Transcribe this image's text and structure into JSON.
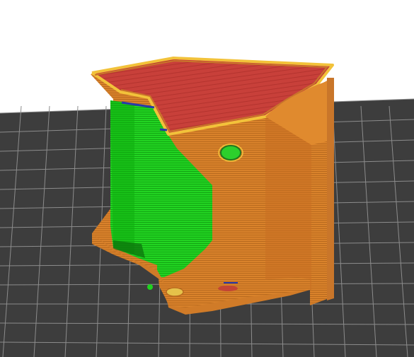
{
  "viewport": {
    "background_color": "#ffffff",
    "bed_color": "#3d3d3d",
    "bed_grid_color": "#8c8c8c"
  },
  "model": {
    "top_surface_color": "#c03838",
    "perimeter_color": "#d9822b",
    "perimeter_highlight_color": "#f2c23a",
    "overhang_color": "#1fd21f",
    "overhang_dark_color": "#0f8f0f",
    "bridge_color": "#2a3aa8",
    "shadow_color": "#8a4a14"
  }
}
